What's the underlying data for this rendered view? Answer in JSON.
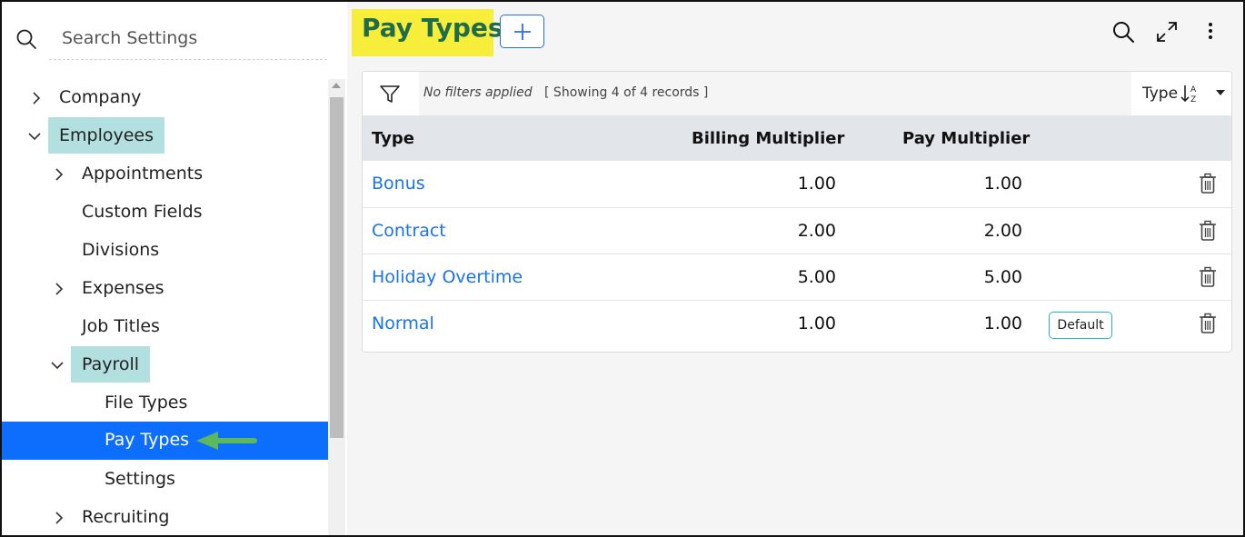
{
  "sidebar": {
    "search_placeholder": "Search Settings",
    "items": [
      {
        "label": "Company",
        "chevron": "right"
      },
      {
        "label": "Employees",
        "chevron": "down",
        "highlighted": true
      },
      {
        "label": "Appointments",
        "chevron": "right"
      },
      {
        "label": "Custom Fields"
      },
      {
        "label": "Divisions"
      },
      {
        "label": "Expenses",
        "chevron": "right"
      },
      {
        "label": "Job Titles"
      },
      {
        "label": "Payroll",
        "chevron": "down",
        "highlighted": true
      },
      {
        "label": "File Types"
      },
      {
        "label": "Pay Types",
        "active": true
      },
      {
        "label": "Settings"
      },
      {
        "label": "Recruiting",
        "chevron": "right"
      }
    ]
  },
  "header": {
    "title": "Pay Types",
    "add_icon": "plus-icon",
    "icons": [
      "search-icon",
      "expand-icon",
      "more-vertical-icon"
    ]
  },
  "filter_bar": {
    "filter_icon": "filter-icon",
    "no_filters": "No filters applied",
    "showing": "[ Showing 4 of 4 records ]",
    "sort_label": "Type",
    "sort_icon": "sort-alpha-icon"
  },
  "table": {
    "columns": [
      "Type",
      "Billing Multiplier",
      "Pay Multiplier"
    ],
    "rows": [
      {
        "type": "Bonus",
        "billing": "1.00",
        "pay": "1.00",
        "badge": ""
      },
      {
        "type": "Contract",
        "billing": "2.00",
        "pay": "2.00",
        "badge": ""
      },
      {
        "type": "Holiday Overtime",
        "billing": "5.00",
        "pay": "5.00",
        "badge": ""
      },
      {
        "type": "Normal",
        "billing": "1.00",
        "pay": "1.00",
        "badge": "Default"
      }
    ]
  },
  "colors": {
    "accent": "#0d6efd",
    "title_highlight": "#f6ee3a",
    "title_text": "#1f6b4a",
    "tree_highlight": "#b2dfdf",
    "link": "#1a73e8",
    "arrow": "#5cb85c"
  }
}
